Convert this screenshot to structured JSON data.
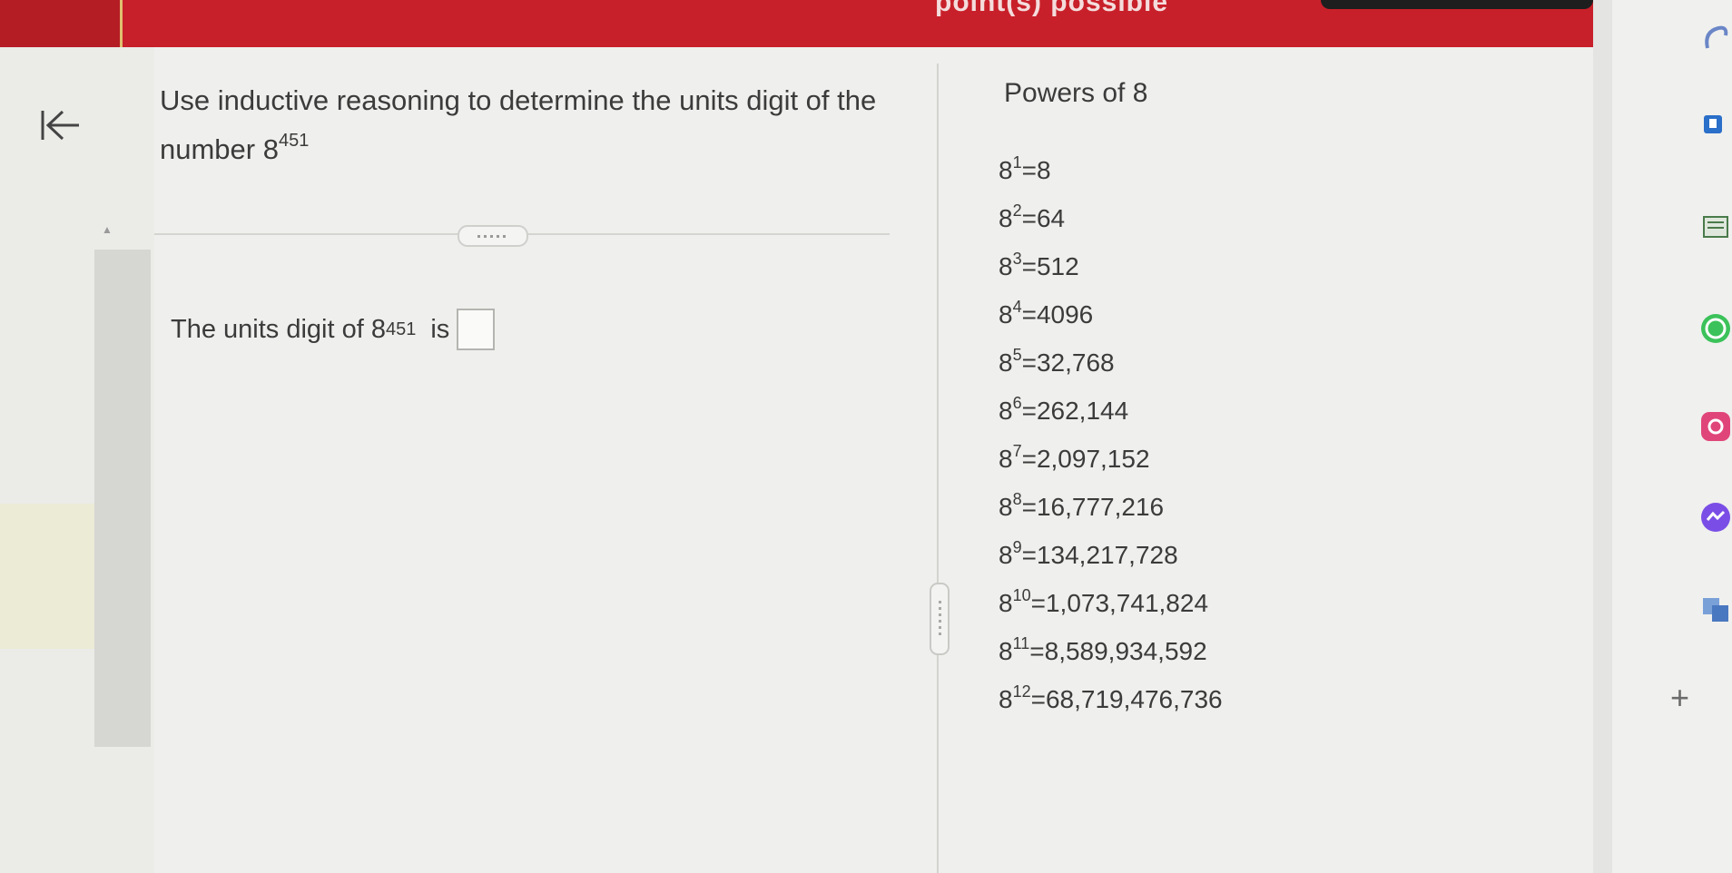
{
  "header": {
    "title": "point(s) possible"
  },
  "question": {
    "text": "Use inductive reasoning to determine the units digit of the number 8",
    "exponent": "451"
  },
  "answer": {
    "prefix": "The units digit of 8",
    "exponent": "451",
    "suffix": "is"
  },
  "powers": {
    "title": "Powers of 8",
    "items": [
      {
        "base": "8",
        "exp": "1",
        "value": "=8"
      },
      {
        "base": "8",
        "exp": "2",
        "value": "=64"
      },
      {
        "base": "8",
        "exp": "3",
        "value": "=512"
      },
      {
        "base": "8",
        "exp": "4",
        "value": "=4096"
      },
      {
        "base": "8",
        "exp": "5",
        "value": "=32,768"
      },
      {
        "base": "8",
        "exp": "6",
        "value": "=262,144"
      },
      {
        "base": "8",
        "exp": "7",
        "value": "=2,097,152"
      },
      {
        "base": "8",
        "exp": "8",
        "value": "=16,777,216"
      },
      {
        "base": "8",
        "exp": "9",
        "value": "=134,217,728"
      },
      {
        "base": "8",
        "exp": "10",
        "value": "=1,073,741,824"
      },
      {
        "base": "8",
        "exp": "11",
        "value": "=8,589,934,592"
      },
      {
        "base": "8",
        "exp": "12",
        "value": "=68,719,476,736"
      }
    ]
  },
  "sidebar_icons": [
    "copilot-icon",
    "outlook-icon",
    "whatsapp-icon",
    "instagram-icon",
    "messenger-icon",
    "translate-icon",
    "add-icon"
  ],
  "colors": {
    "header": "#c8202a"
  }
}
